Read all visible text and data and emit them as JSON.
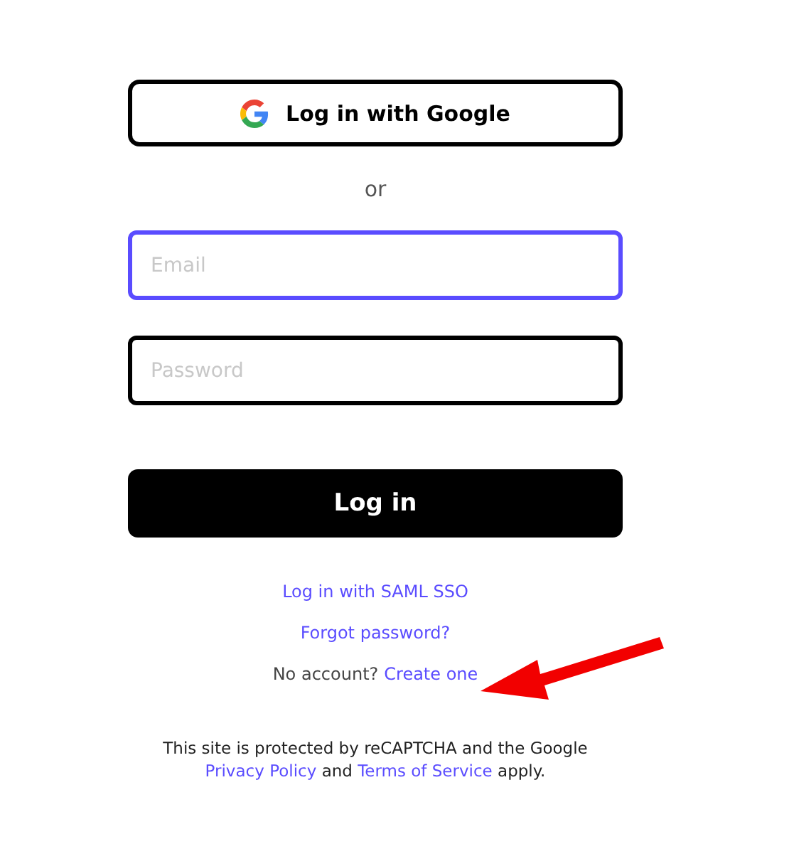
{
  "google_button": {
    "label": "Log in with Google"
  },
  "separator": "or",
  "fields": [
    {
      "placeholder": "Email",
      "focused": true
    },
    {
      "placeholder": "Password",
      "focused": false
    }
  ],
  "login_button": {
    "label": "Log in"
  },
  "links": [
    "Log in with SAML SSO",
    "Forgot password?"
  ],
  "signup": {
    "text": "No account?",
    "link": "Create one"
  },
  "notice": [
    {
      "kind": "text",
      "text": "This site is protected by reCAPTCHA and the Google"
    },
    {
      "kind": "link",
      "text": "Privacy Policy"
    },
    {
      "kind": "text",
      "text": "and"
    },
    {
      "kind": "link",
      "text": "Terms of Service"
    },
    {
      "kind": "text",
      "text": "apply."
    }
  ],
  "annotation": {
    "kind": "arrow"
  }
}
